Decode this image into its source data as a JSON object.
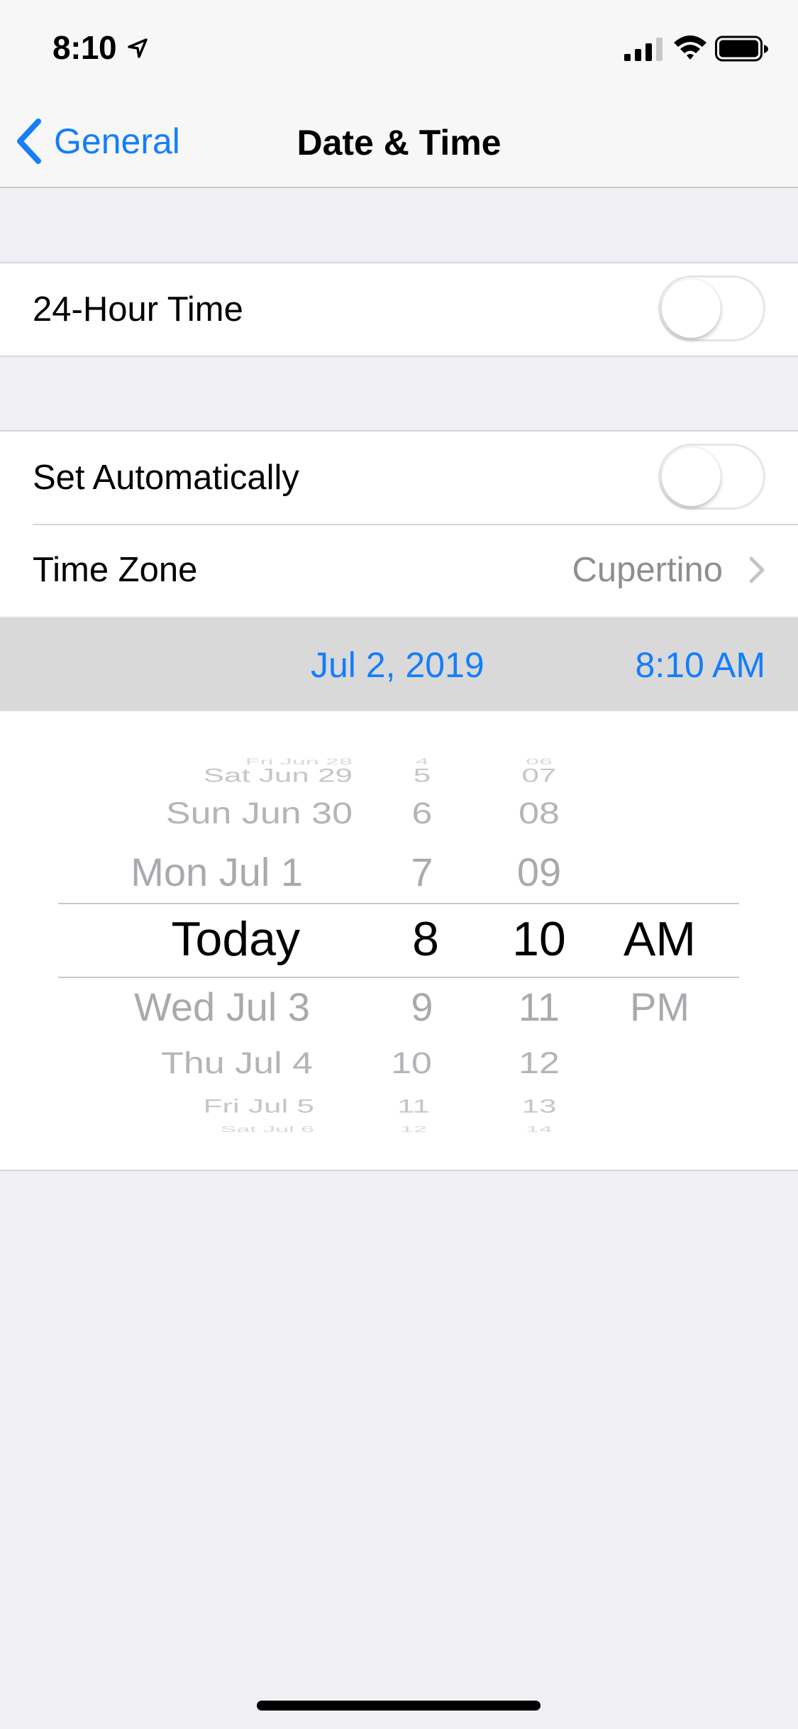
{
  "status_bar": {
    "time": "8:10"
  },
  "nav": {
    "back_label": "General",
    "title": "Date & Time"
  },
  "settings": {
    "hour24_label": "24-Hour Time",
    "set_auto_label": "Set Automatically",
    "timezone_label": "Time Zone",
    "timezone_value": "Cupertino"
  },
  "datetime": {
    "date": "Jul 2, 2019",
    "time": "8:10 AM"
  },
  "picker": {
    "dates": [
      "Fri Jun 28",
      "Sat Jun 29",
      "Sun Jun 30",
      "Mon Jul 1",
      "Today",
      "Wed Jul 3",
      "Thu Jul 4",
      "Fri Jul 5",
      "Sat Jul 6"
    ],
    "hours": [
      "4",
      "5",
      "6",
      "7",
      "8",
      "9",
      "10",
      "11",
      "12"
    ],
    "minutes": [
      "06",
      "07",
      "08",
      "09",
      "10",
      "11",
      "12",
      "13",
      "14"
    ],
    "ampm": [
      "AM",
      "PM"
    ]
  },
  "colors": {
    "accent": "#147efb",
    "background": "#efeff4",
    "secondary_text": "#8e8e93"
  }
}
